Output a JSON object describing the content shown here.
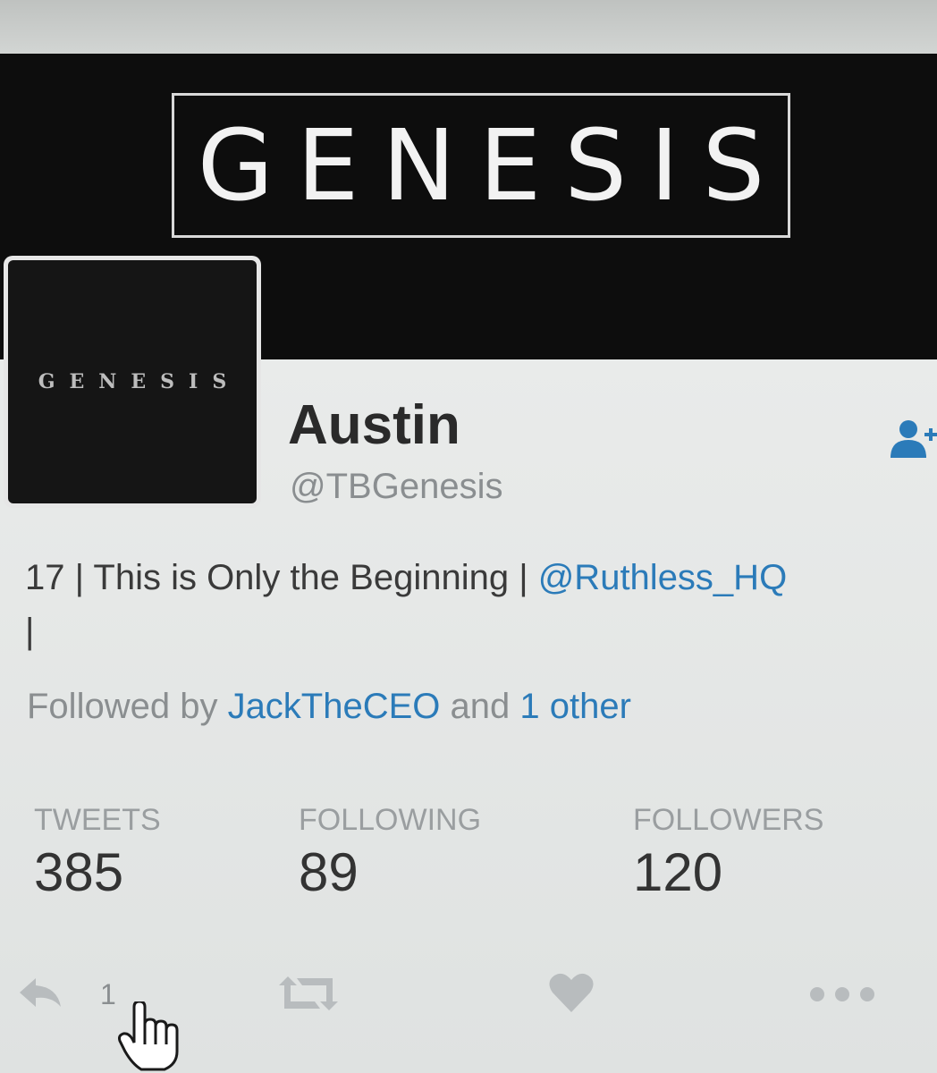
{
  "banner": {
    "logo_text": "GENESIS"
  },
  "avatar": {
    "logo_text": "GENESIS"
  },
  "profile": {
    "name": "Austin",
    "handle": "@TBGenesis",
    "bio_text": "17 | This is Only the Beginning | ",
    "bio_mention": "@Ruthless_HQ",
    "bio_tail": "|"
  },
  "followed_by": {
    "prefix": "Followed by ",
    "user": "JackTheCEO",
    "middle": " and ",
    "other": "1 other"
  },
  "stats": [
    {
      "label": "TWEETS",
      "value": "385"
    },
    {
      "label": "FOLLOWING",
      "value": "89"
    },
    {
      "label": "FOLLOWERS",
      "value": "120"
    }
  ],
  "actions": {
    "reply_icon": "reply-icon",
    "reply_count": "1",
    "retweet_icon": "retweet-icon",
    "like_icon": "heart-icon",
    "more_icon": "more-icon",
    "cursor_icon": "hand-pointer-icon"
  },
  "colors": {
    "link": "#2b7bb9",
    "banner_bg": "#0d0d0d",
    "card_bg": "#e9ebea",
    "muted": "#8a8e90"
  }
}
